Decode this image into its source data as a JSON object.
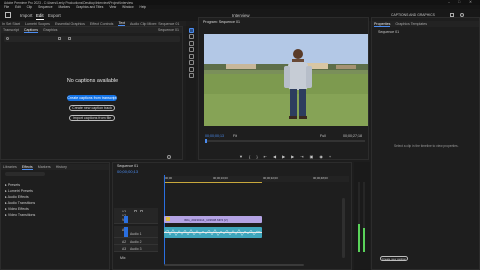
{
  "window": {
    "title": "Adobe Premiere Pro 2023 - C:\\Users\\Lenly Productions\\Desktop\\Interview\\Project\\Interview"
  },
  "menubar": [
    "File",
    "Edit",
    "Clip",
    "Sequence",
    "Markers",
    "Graphics and Titles",
    "View",
    "Window",
    "Help"
  ],
  "workspace_tabs": [
    "Import",
    "Edit",
    "Export"
  ],
  "app_title_center": "Interview",
  "top_right": {
    "workspace_label": "CAPTIONS AND GRAPHICS"
  },
  "left_panel": {
    "tabs": [
      "Transcript",
      "Captions",
      "Graphics"
    ],
    "sequence_label": "Sequence 01",
    "no_captions_title": "No captions available",
    "create_from_transcript": "Create captions from transcript",
    "create_new_track": "Create new caption track",
    "import_from_file": "Import captions from file"
  },
  "upper_tabs": [
    "In Set Start",
    "Lumetri Scopes",
    "Essential Graphics",
    "Effect Controls",
    "Text",
    "Audio Clip Mixer: Sequence 01"
  ],
  "program_monitor": {
    "title": "Program: Sequence 01",
    "timecode_left": "00;00;00;13",
    "fit_label": "Fit",
    "quality_label": "Full",
    "timecode_right": "00;00;27;18"
  },
  "properties_panel": {
    "tabs": [
      "Properties",
      "Graphics Templates"
    ],
    "sequence_label": "Sequence 01",
    "hint_text": "Select a clip in the timeline to view properties."
  },
  "project_panel": {
    "tabs": [
      "Libraries",
      "Effects",
      "Markers",
      "History"
    ],
    "items": [
      "Presets",
      "Lumetri Presets",
      "Audio Effects",
      "Audio Transitions",
      "Video Effects",
      "Video Transitions"
    ]
  },
  "timeline": {
    "title": "Sequence 01",
    "timecode": "00;00;00;13",
    "ruler_ticks": [
      "00;00",
      "00;00;16;00",
      "00;00;32;00",
      "00;00;48;00"
    ],
    "tracks_video": [
      "V3",
      "V2",
      "V1"
    ],
    "tracks_audio": [
      "A1",
      "A2",
      "A3"
    ],
    "audio_names": [
      "Audio 1",
      "Audio 2",
      "Audio 3"
    ],
    "clip_label": "IMG_20230114_103608.MP4 [V]",
    "mix_label": "Mix"
  },
  "statusbar": {
    "new_caption_label": "Create new caption"
  },
  "colors": {
    "accent": "#1473e6",
    "video_clip": "#b0a0e0",
    "audio_clip": "#4fb2c7",
    "playhead": "#2a6fe0",
    "green_bar": "#5ad25a"
  }
}
